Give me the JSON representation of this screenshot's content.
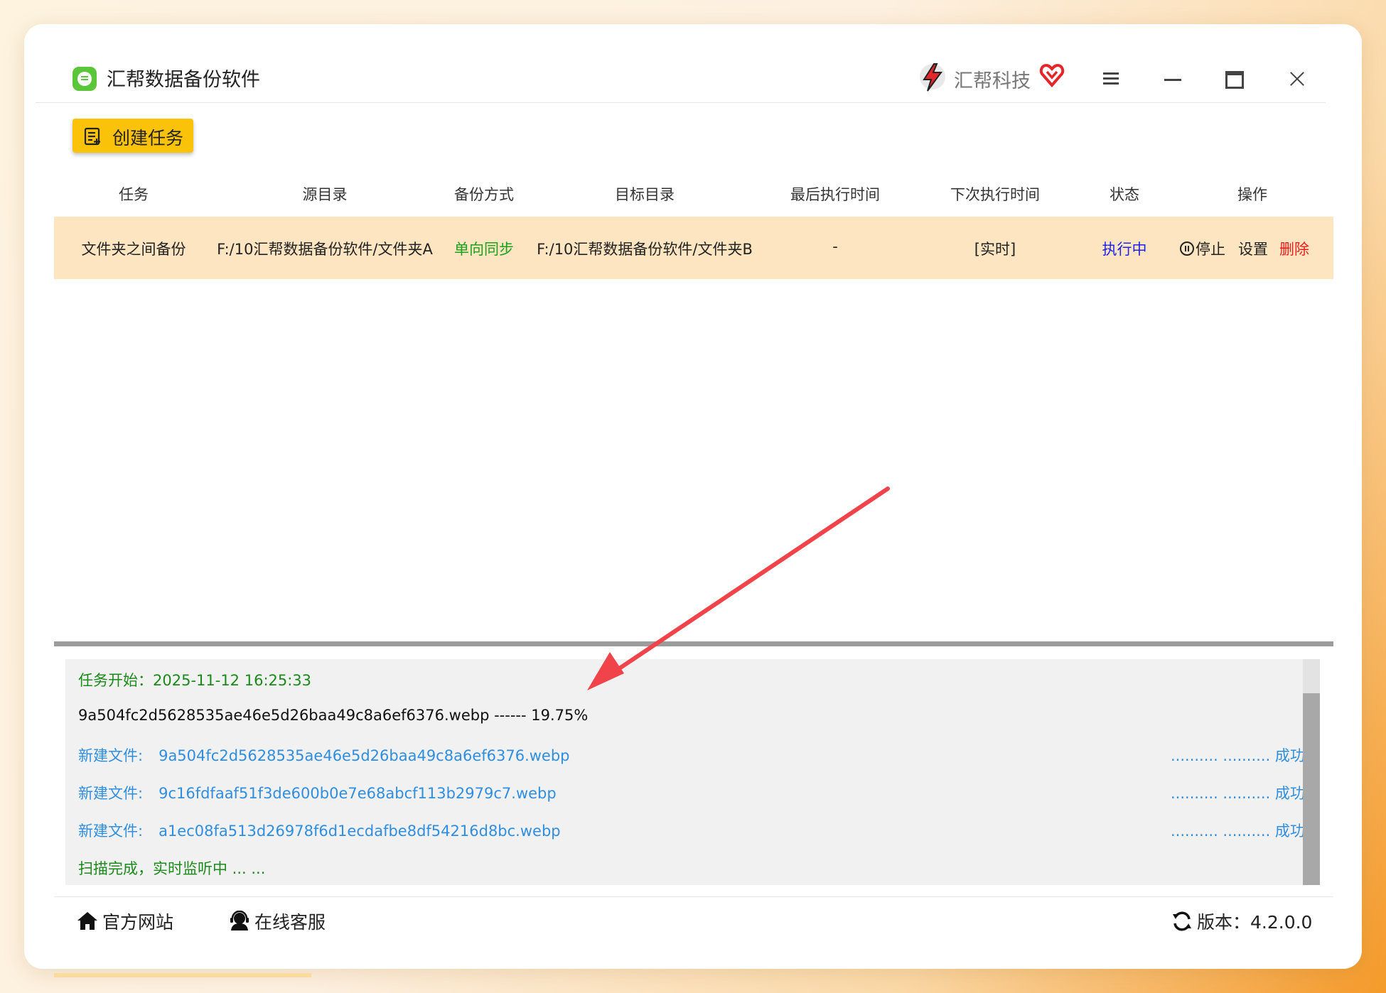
{
  "app": {
    "title": "汇帮数据备份软件",
    "brand": "汇帮科技"
  },
  "toolbar": {
    "create_label": "创建任务"
  },
  "table": {
    "headers": [
      "任务",
      "源目录",
      "备份方式",
      "目标目录",
      "最后执行时间",
      "下次执行时间",
      "状态",
      "操作"
    ],
    "rows": [
      {
        "task": "文件夹之间备份",
        "source": "F:/10汇帮数据备份软件/文件夹A",
        "mode": "单向同步",
        "target": "F:/10汇帮数据备份软件/文件夹B",
        "last_run": "-",
        "next_run": "[实时]",
        "status": "执行中",
        "actions": {
          "stop": "停止",
          "settings": "设置",
          "delete": "删除"
        }
      }
    ]
  },
  "log": {
    "start_line": "任务开始：2025-11-12 16:25:33",
    "progress_line": "9a504fc2d5628535ae46e5d26baa49c8a6ef6376.webp ------ 19.75%",
    "entries": [
      {
        "label": "新建文件:",
        "file": "9a504fc2d5628535ae46e5d26baa49c8a6ef6376.webp",
        "status": ".......... .......... 成功"
      },
      {
        "label": "新建文件:",
        "file": "9c16fdfaaf51f3de600b0e7e68abcf113b2979c7.webp",
        "status": ".......... .......... 成功"
      },
      {
        "label": "新建文件:",
        "file": "a1ec08fa513d26978f6d1ecdafbe8df54216d8bc.webp",
        "status": ".......... .......... 成功"
      }
    ],
    "end_line": "扫描完成，实时监听中 ... ..."
  },
  "footer": {
    "website": "官方网站",
    "support": "在线客服",
    "version": "版本：4.2.0.0"
  },
  "colors": {
    "accent_yellow": "#fbc20a",
    "row_highlight": "#fce5c0",
    "status_blue": "#1f23e6",
    "mode_green": "#1ca11c",
    "delete_red": "#ee1c1c",
    "log_blue": "#2f8ee0",
    "annotation_arrow": "#f0434a"
  },
  "icons": {
    "app": "app-logo-icon",
    "brand": "brand-logo-icon",
    "vip": "vip-heart-icon",
    "menu": "hamburger-icon",
    "minimize": "minimize-icon",
    "maximize": "maximize-icon",
    "close": "close-icon",
    "create": "task-list-icon",
    "stop": "pause-icon",
    "home": "home-icon",
    "support": "headset-icon",
    "refresh": "refresh-icon"
  }
}
